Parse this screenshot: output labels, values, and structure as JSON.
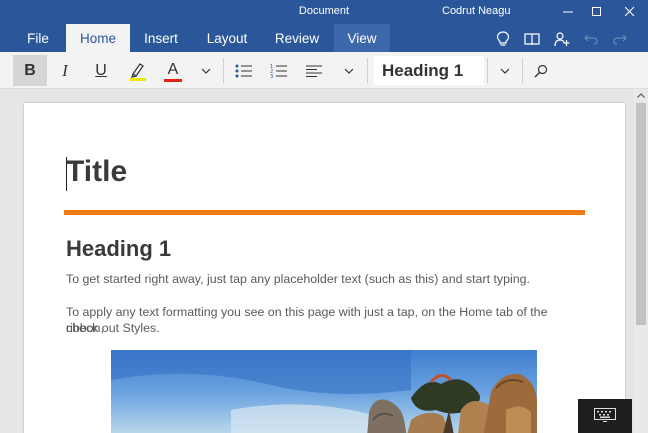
{
  "titlebar": {
    "title": "Document",
    "user": "Codrut Neagu",
    "background": "#2b579a"
  },
  "ribbon": {
    "tabs": [
      {
        "label": "File",
        "state": "normal"
      },
      {
        "label": "Home",
        "state": "active"
      },
      {
        "label": "Insert",
        "state": "normal"
      },
      {
        "label": "Layout",
        "state": "normal"
      },
      {
        "label": "Review",
        "state": "normal"
      },
      {
        "label": "View",
        "state": "hover"
      }
    ],
    "icons": [
      "lightbulb-icon",
      "read-mode-icon",
      "share-person-icon",
      "undo-icon",
      "redo-icon"
    ]
  },
  "toolbar": {
    "bold": "B",
    "italic": "I",
    "underline": "U",
    "font_color_letter": "A",
    "highlight_color": "#f2e600",
    "font_color": "#e0261a",
    "current_style": "Heading 1",
    "icons": [
      "bullets-icon",
      "numbering-icon",
      "align-left-icon",
      "search-icon"
    ]
  },
  "document": {
    "title": "Title",
    "accent_color": "#f57c14",
    "heading": "Heading 1",
    "paragraph1": "To get started right away, just tap any placeholder text (such as this) and start typing.",
    "paragraph2_line1": "To apply any text formatting you see on this page with just a tap, on the Home tab of the ribbon,",
    "paragraph2_line2": "check out Styles."
  }
}
